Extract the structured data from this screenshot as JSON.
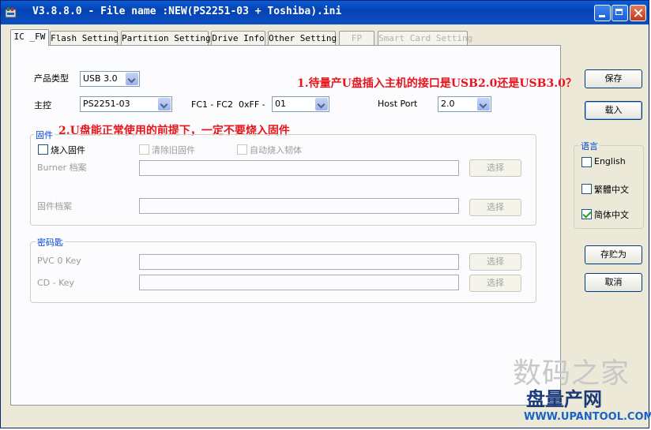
{
  "window": {
    "title": "V3.8.8.0 - File name :NEW(PS2251-03 + Toshiba).ini"
  },
  "tabs": [
    {
      "label": "IC _FW",
      "state": "active"
    },
    {
      "label": "Flash Setting",
      "state": "normal"
    },
    {
      "label": "Partition Setting",
      "state": "normal"
    },
    {
      "label": "Drive Info",
      "state": "normal"
    },
    {
      "label": "Other Setting",
      "state": "normal"
    },
    {
      "label": "FP",
      "state": "disabled"
    },
    {
      "label": "Smart Card Setting",
      "state": "disabled"
    }
  ],
  "form": {
    "product_type_label": "产品类型",
    "product_type_value": "USB 3.0",
    "controller_label": "主控",
    "controller_value": "PS2251-03",
    "fc_label": "FC1 - FC2",
    "fc_hex_label": "0xFF -",
    "fc_value": "01",
    "host_port_label": "Host Port",
    "host_port_value": "2.0"
  },
  "annotations": {
    "note1": "1.待量产U盘插入主机的接口是USB2.0还是USB3.0？",
    "note2": "2.U盘能正常使用的前提下，一定不要烧入固件"
  },
  "firmware": {
    "group_title": "固件",
    "burn_fw_label": "烧入固件",
    "clear_old_fw_label": "清除旧固件",
    "auto_burn_label": "自动烧入韧体",
    "burner_file_label": "Burner 档案",
    "fw_file_label": "固件档案",
    "select_label": "选择"
  },
  "key": {
    "group_title": "密码匙",
    "pvc_label": "PVC 0 Key",
    "cd_label": "CD - Key",
    "select_label": "选择"
  },
  "buttons": {
    "save": "保存",
    "load": "载入",
    "save_as": "存贮为",
    "cancel": "取消"
  },
  "language": {
    "group_title": "语言",
    "english": "English",
    "traditional": "繁體中文",
    "simplified": "简体中文",
    "selected": "simplified"
  },
  "watermark": {
    "line1": "数码之家",
    "line2": "盘量产网",
    "line3": "WWW.UPANTOOL.COM"
  },
  "colors": {
    "title_bar": "#0a5bd6",
    "annotation_red": "#e8141b",
    "group_title_blue": "#0046d5",
    "face": "#ece9d8"
  }
}
